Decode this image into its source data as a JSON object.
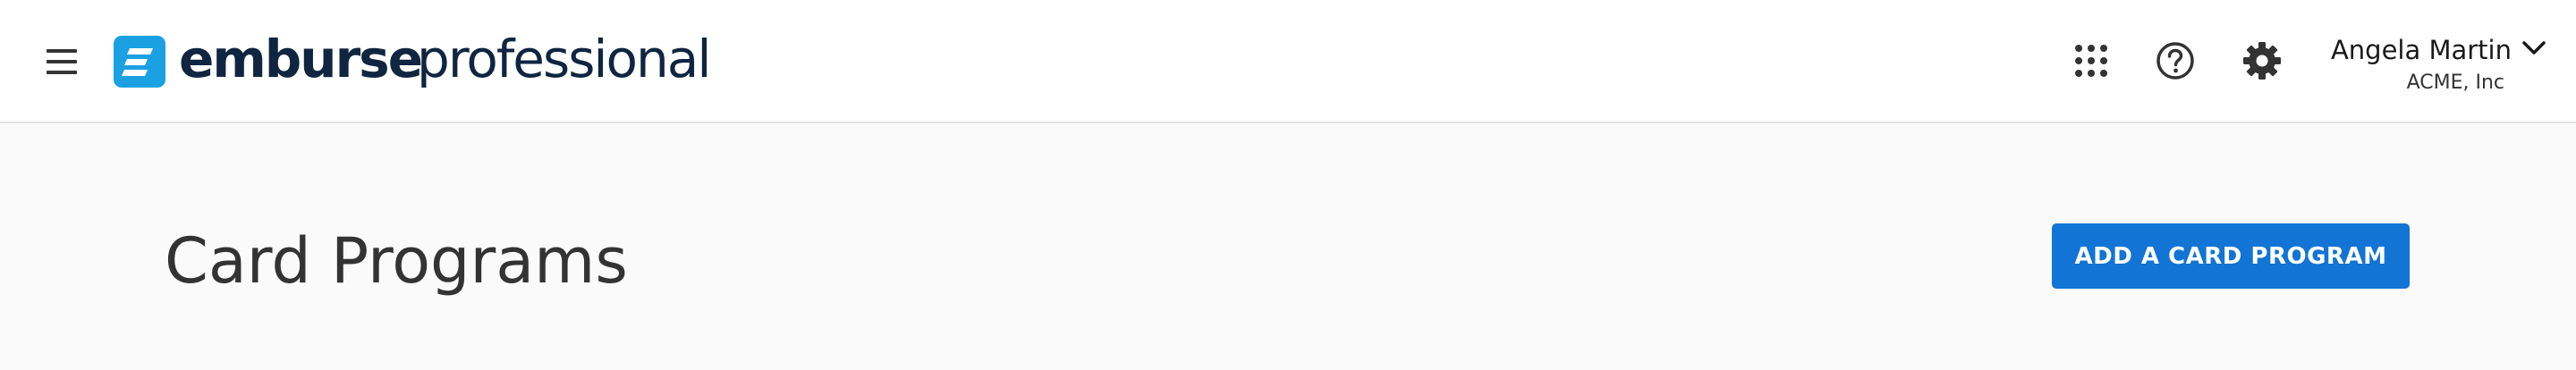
{
  "header": {
    "brand_name": "emburse",
    "brand_product": "professional",
    "brand_color": "#1ba1e2",
    "menu_icon": "hamburger-menu-icon",
    "icons": {
      "apps": "apps-grid-icon",
      "help": "help-circle-icon",
      "settings": "gear-icon"
    },
    "user": {
      "name": "Angela Martin",
      "company": "ACME, Inc",
      "dropdown_icon": "chevron-down-icon"
    }
  },
  "main": {
    "title": "Card Programs",
    "add_button_label": "ADD A CARD PROGRAM",
    "accent_color": "#1274d4"
  }
}
